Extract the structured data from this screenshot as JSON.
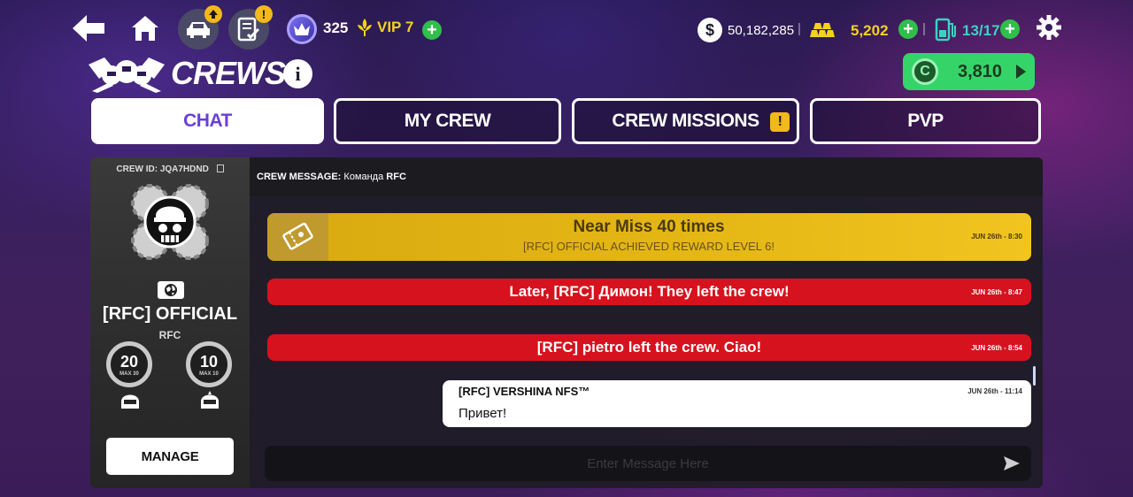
{
  "topbar": {
    "level": "325",
    "vip_label": "VIP 7",
    "money": "50,182,285",
    "gold": "5,202",
    "fuel": "13/17",
    "currency_symbol": "$",
    "badge_symbol": "!"
  },
  "header": {
    "title": "CREWS",
    "info_symbol": "i",
    "coin_value": "3,810",
    "coin_symbol": "C"
  },
  "tabs": [
    {
      "label": "CHAT",
      "active": true
    },
    {
      "label": "MY CREW",
      "active": false
    },
    {
      "label": "CREW MISSIONS",
      "active": false,
      "alert": "!"
    },
    {
      "label": "PVP",
      "active": false
    }
  ],
  "crew": {
    "crew_id": "CREW ID: JQA7HDND",
    "name": "[RFC] OFFICIAL",
    "tag": "RFC",
    "gauge_left": {
      "value": "20",
      "max": "MAX 30"
    },
    "gauge_right": {
      "value": "10",
      "max": "MAX 10"
    },
    "manage_label": "MANAGE"
  },
  "chat": {
    "crew_message_label": "CREW MESSAGE:",
    "crew_message_text": "Команда",
    "crew_message_tag": "RFC",
    "messages": [
      {
        "type": "achievement",
        "title": "Near Miss 40 times",
        "subtitle": "[RFC] OFFICIAL ACHIEVED REWARD LEVEL 6!",
        "time": "JUN 26th - 8:30"
      },
      {
        "type": "system",
        "text": "Later, [RFC] Димон! They left the crew!",
        "time": "JUN 26th - 8:47"
      },
      {
        "type": "system",
        "text": "[RFC] pietro left the crew. Ciao!",
        "time": "JUN 26th - 8:54"
      },
      {
        "type": "user",
        "author": "[RFC] VERSHINA NFS™",
        "text": "Привет!",
        "time": "JUN 26th - 11:14"
      }
    ],
    "input_placeholder": "Enter Message Here"
  },
  "colors": {
    "accent_purple": "#6a3fd6",
    "achievement_gold": "#e6b815",
    "system_red": "#d6121e",
    "cash_green": "#35d469"
  }
}
